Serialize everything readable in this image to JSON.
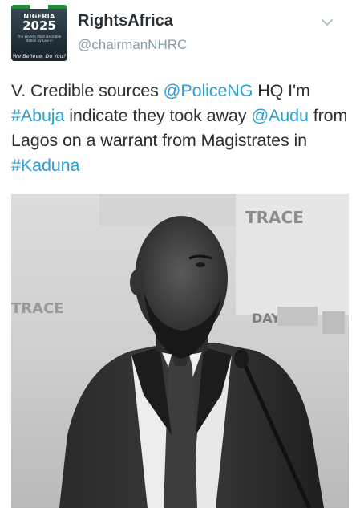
{
  "tweet": {
    "avatar": {
      "line1": "NIGERIA",
      "line2": "2025",
      "line3": "The World's Most Desirable Nation by Law in",
      "line4": "We Believe, Do You?"
    },
    "display_name": "RightsAfrica",
    "username": "@chairmanNHRC",
    "text": {
      "t1": "V. Credible sources ",
      "m1": "@PoliceNG",
      "t2": " HQ I'm ",
      "h1": "#Abuja",
      "t3": " indicate they took away ",
      "m2": "@Audu",
      "t4": " from Lagos on a warrant from Magistrates in ",
      "h2": "#Kaduna"
    },
    "photo": {
      "backdrop_text_1": "TRACE",
      "backdrop_text_2": "TRACE",
      "backdrop_text_3": "DAY"
    }
  },
  "colors": {
    "link": "#2b9fd3",
    "text": "#292f33",
    "muted": "#8899a6"
  },
  "icons": {
    "menu": "chevron-down-icon"
  }
}
